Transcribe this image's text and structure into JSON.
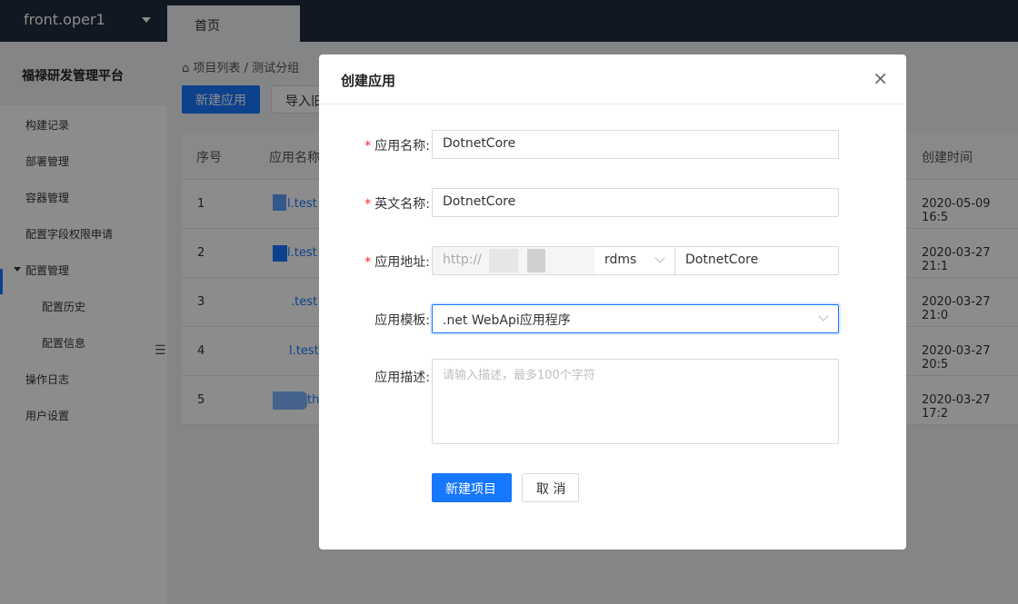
{
  "topbar": {
    "account": "front.oper1",
    "home_tab": "首页"
  },
  "sidebar": {
    "brand": "福禄研发管理平台",
    "items": [
      {
        "label": "构建记录"
      },
      {
        "label": "部署管理"
      },
      {
        "label": "容器管理"
      },
      {
        "label": "配置字段权限申请"
      },
      {
        "label": "配置管理"
      },
      {
        "label": "配置历史"
      },
      {
        "label": "配置信息"
      },
      {
        "label": "操作日志"
      },
      {
        "label": "用户设置"
      }
    ]
  },
  "main": {
    "breadcrumb": {
      "root": "项目列表",
      "sep": "/",
      "current": "测试分组"
    },
    "buttons": {
      "new_app": "新建应用",
      "import": "导入旧"
    },
    "table": {
      "headers": {
        "index": "序号",
        "name": "应用名称",
        "created": "创建时间"
      },
      "rows": [
        {
          "index": "1",
          "name": "l.test",
          "created": "2020-05-09 16:5"
        },
        {
          "index": "2",
          "name": "l.test",
          "created": "2020-03-27 21:1"
        },
        {
          "index": "3",
          "name": ".test",
          "created": "2020-03-27 21:0"
        },
        {
          "index": "4",
          "name": "l.test",
          "created": "2020-03-27 20:5"
        },
        {
          "index": "5",
          "name": "th",
          "created": "2020-03-27 17:2"
        }
      ]
    }
  },
  "modal": {
    "title": "创建应用",
    "close": "×",
    "required_mark": "*",
    "fields": {
      "app_name": {
        "label": "应用名称:",
        "value": "DotnetCore"
      },
      "en_name": {
        "label": "英文名称:",
        "value": "DotnetCore"
      },
      "address": {
        "label": "应用地址:",
        "protocol": "http://",
        "group": "rdms",
        "name": "DotnetCore"
      },
      "template": {
        "label": "应用模板:",
        "value": ".net WebApi应用程序"
      },
      "description": {
        "label": "应用描述:",
        "placeholder": "请输入描述，最多100个字符"
      }
    },
    "buttons": {
      "submit": "新建项目",
      "cancel": "取 消"
    }
  },
  "colors": {
    "primary": "#1677ff",
    "topbar": "#1f2d3d",
    "required": "#f5222d"
  }
}
